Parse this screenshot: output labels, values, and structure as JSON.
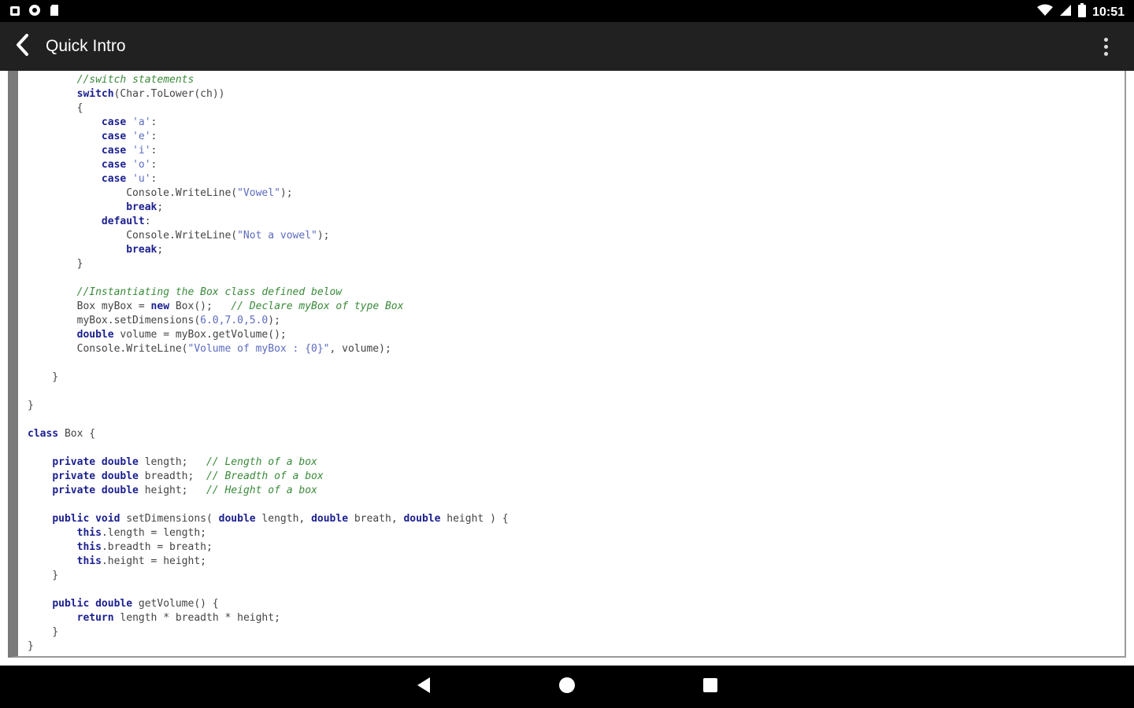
{
  "status_bar": {
    "time": "10:51",
    "left_icons": [
      "notification-icon",
      "sync-icon",
      "sd-card-icon"
    ],
    "right_icons": [
      "wifi-icon",
      "cell-signal-icon",
      "battery-icon"
    ]
  },
  "app_bar": {
    "title": "Quick Intro",
    "back_icon": "back-arrow-icon",
    "menu_icon": "overflow-menu-icon"
  },
  "code": {
    "lines": [
      [
        {
          "t": "        "
        },
        {
          "t": "//switch statements",
          "c": "cm"
        }
      ],
      [
        {
          "t": "        "
        },
        {
          "t": "switch",
          "c": "kw"
        },
        {
          "t": "(Char.ToLower(ch))"
        }
      ],
      [
        {
          "t": "        {"
        }
      ],
      [
        {
          "t": "            "
        },
        {
          "t": "case",
          "c": "kw"
        },
        {
          "t": " "
        },
        {
          "t": "'a'",
          "c": "st"
        },
        {
          "t": ":"
        }
      ],
      [
        {
          "t": "            "
        },
        {
          "t": "case",
          "c": "kw"
        },
        {
          "t": " "
        },
        {
          "t": "'e'",
          "c": "st"
        },
        {
          "t": ":"
        }
      ],
      [
        {
          "t": "            "
        },
        {
          "t": "case",
          "c": "kw"
        },
        {
          "t": " "
        },
        {
          "t": "'i'",
          "c": "st"
        },
        {
          "t": ":"
        }
      ],
      [
        {
          "t": "            "
        },
        {
          "t": "case",
          "c": "kw"
        },
        {
          "t": " "
        },
        {
          "t": "'o'",
          "c": "st"
        },
        {
          "t": ":"
        }
      ],
      [
        {
          "t": "            "
        },
        {
          "t": "case",
          "c": "kw"
        },
        {
          "t": " "
        },
        {
          "t": "'u'",
          "c": "st"
        },
        {
          "t": ":"
        }
      ],
      [
        {
          "t": "                Console.WriteLine("
        },
        {
          "t": "\"Vowel\"",
          "c": "st"
        },
        {
          "t": ");"
        }
      ],
      [
        {
          "t": "                "
        },
        {
          "t": "break",
          "c": "kw"
        },
        {
          "t": ";"
        }
      ],
      [
        {
          "t": "            "
        },
        {
          "t": "default",
          "c": "kw"
        },
        {
          "t": ":"
        }
      ],
      [
        {
          "t": "                Console.WriteLine("
        },
        {
          "t": "\"Not a vowel\"",
          "c": "st"
        },
        {
          "t": ");"
        }
      ],
      [
        {
          "t": "                "
        },
        {
          "t": "break",
          "c": "kw"
        },
        {
          "t": ";"
        }
      ],
      [
        {
          "t": "        }"
        }
      ],
      [],
      [
        {
          "t": "        "
        },
        {
          "t": "//Instantiating the Box class defined below",
          "c": "cm"
        }
      ],
      [
        {
          "t": "        Box myBox = "
        },
        {
          "t": "new",
          "c": "kw"
        },
        {
          "t": " Box();   "
        },
        {
          "t": "// Declare myBox of type Box",
          "c": "cm"
        }
      ],
      [
        {
          "t": "        myBox.setDimensions("
        },
        {
          "t": "6.0,7.0,5.0",
          "c": "st"
        },
        {
          "t": ");"
        }
      ],
      [
        {
          "t": "        "
        },
        {
          "t": "double",
          "c": "kw"
        },
        {
          "t": " volume = myBox.getVolume();"
        }
      ],
      [
        {
          "t": "        Console.WriteLine("
        },
        {
          "t": "\"Volume of myBox : {0}\"",
          "c": "st"
        },
        {
          "t": ", volume);"
        }
      ],
      [],
      [
        {
          "t": "    }"
        }
      ],
      [],
      [
        {
          "t": "}"
        }
      ],
      [],
      [
        {
          "t": "class",
          "c": "kw"
        },
        {
          "t": " Box {"
        }
      ],
      [],
      [
        {
          "t": "    "
        },
        {
          "t": "private double",
          "c": "kw"
        },
        {
          "t": " length;   "
        },
        {
          "t": "// Length of a box",
          "c": "cm"
        }
      ],
      [
        {
          "t": "    "
        },
        {
          "t": "private double",
          "c": "kw"
        },
        {
          "t": " breadth;  "
        },
        {
          "t": "// Breadth of a box",
          "c": "cm"
        }
      ],
      [
        {
          "t": "    "
        },
        {
          "t": "private double",
          "c": "kw"
        },
        {
          "t": " height;   "
        },
        {
          "t": "// Height of a box",
          "c": "cm"
        }
      ],
      [],
      [
        {
          "t": "    "
        },
        {
          "t": "public void",
          "c": "kw"
        },
        {
          "t": " setDimensions( "
        },
        {
          "t": "double",
          "c": "kw"
        },
        {
          "t": " length, "
        },
        {
          "t": "double",
          "c": "kw"
        },
        {
          "t": " breath, "
        },
        {
          "t": "double",
          "c": "kw"
        },
        {
          "t": " height ) {"
        }
      ],
      [
        {
          "t": "        "
        },
        {
          "t": "this",
          "c": "kw"
        },
        {
          "t": ".length = length;"
        }
      ],
      [
        {
          "t": "        "
        },
        {
          "t": "this",
          "c": "kw"
        },
        {
          "t": ".breadth = breath;"
        }
      ],
      [
        {
          "t": "        "
        },
        {
          "t": "this",
          "c": "kw"
        },
        {
          "t": ".height = height;"
        }
      ],
      [
        {
          "t": "    }"
        }
      ],
      [],
      [
        {
          "t": "    "
        },
        {
          "t": "public double",
          "c": "kw"
        },
        {
          "t": " getVolume() {"
        }
      ],
      [
        {
          "t": "        "
        },
        {
          "t": "return",
          "c": "kw"
        },
        {
          "t": " length * breadth * height;"
        }
      ],
      [
        {
          "t": "    }"
        }
      ],
      [
        {
          "t": "}"
        }
      ]
    ]
  },
  "nav_bar": {
    "back_icon": "nav-back-icon",
    "home_icon": "nav-home-icon",
    "recents_icon": "nav-recents-icon"
  }
}
